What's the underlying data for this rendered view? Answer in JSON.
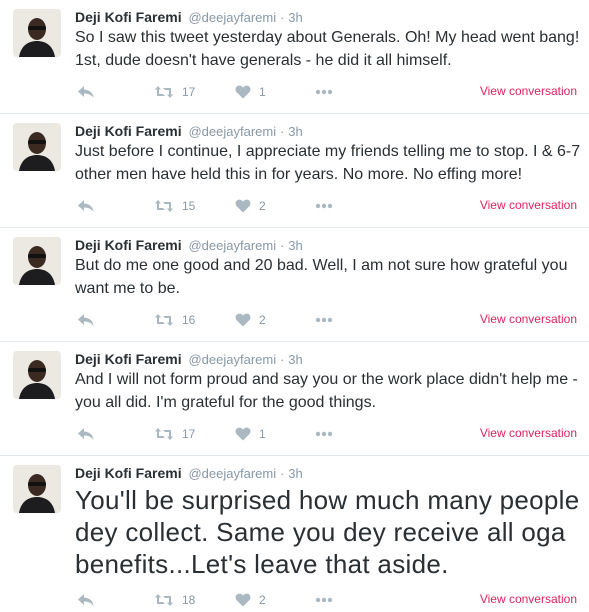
{
  "author": {
    "name": "Deji Kofi Faremi",
    "handle": "@deejayfaremi",
    "separator": "·"
  },
  "view_conversation_label": "View conversation",
  "colors": {
    "link": "#e0245e",
    "muted": "#8899a6",
    "text": "#292f33"
  },
  "icons": {
    "reply": "reply-icon",
    "retweet": "retweet-icon",
    "like": "heart-icon",
    "more": "more-dots-icon"
  },
  "tweets": [
    {
      "time": "3h",
      "text": "So I saw this tweet yesterday about Generals. Oh! My head went bang! 1st, dude doesn't have generals - he did it all himself.",
      "retweets": "17",
      "likes": "1"
    },
    {
      "time": "3h",
      "text": "Just before I continue, I appreciate my friends telling me to stop. I & 6-7 other men have held this in for years. No more. No effing more!",
      "retweets": "15",
      "likes": "2"
    },
    {
      "time": "3h",
      "text": "But do me one good and 20 bad. Well, I am not sure how grateful you want me to be.",
      "retweets": "16",
      "likes": "2"
    },
    {
      "time": "3h",
      "text": "And I will not form proud and say you or the work place didn't help me - you all did. I'm grateful for the good things.",
      "retweets": "17",
      "likes": "1"
    },
    {
      "time": "3h",
      "text": "You'll be surprised how much many people dey collect. Same you dey receive all oga benefits...Let's leave that aside.",
      "retweets": "18",
      "likes": "2"
    }
  ]
}
